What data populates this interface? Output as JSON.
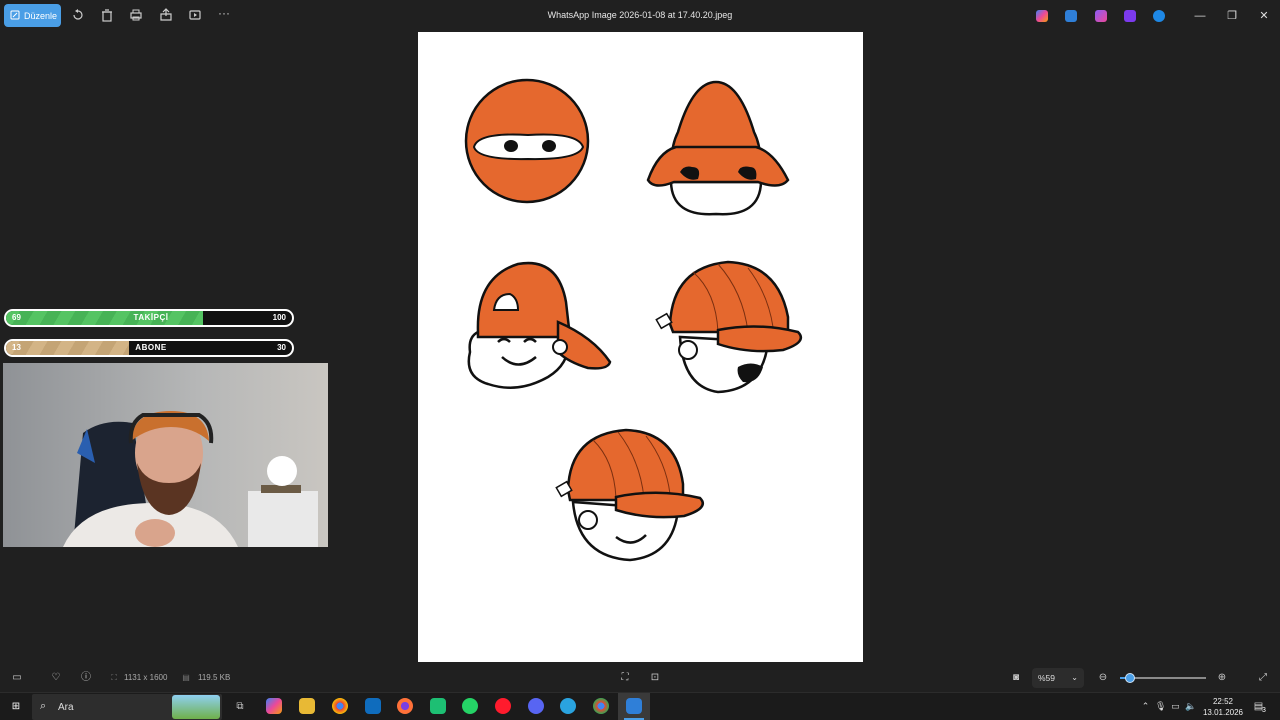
{
  "toolbar": {
    "edit_label": "Düzenle",
    "title": "WhatsApp Image 2026-01-08 at 17.40.20.jpeg",
    "icons": [
      "rotate-icon",
      "delete-icon",
      "print-icon",
      "share-icon",
      "slideshow-icon",
      "more-icon"
    ]
  },
  "overlay": {
    "followers": {
      "current": "69",
      "label": "TAKİPÇİ",
      "goal": "100",
      "progress": 0.69,
      "color": "#55c463"
    },
    "subscribers": {
      "current": "13",
      "label": "ABONE",
      "goal": "30",
      "progress": 0.43,
      "color": "#d3b486"
    }
  },
  "status": {
    "dimensions": "1131 x 1600",
    "filesize": "119.5 KB",
    "zoom": "%59",
    "zoom_level": 0.12
  },
  "taskbar": {
    "search_label": "Ara",
    "time": "22:52",
    "date": "13.01.2026",
    "notification_count": "3"
  },
  "colors": {
    "accent": "#4a9ee6",
    "character_orange": "#e5682e"
  }
}
